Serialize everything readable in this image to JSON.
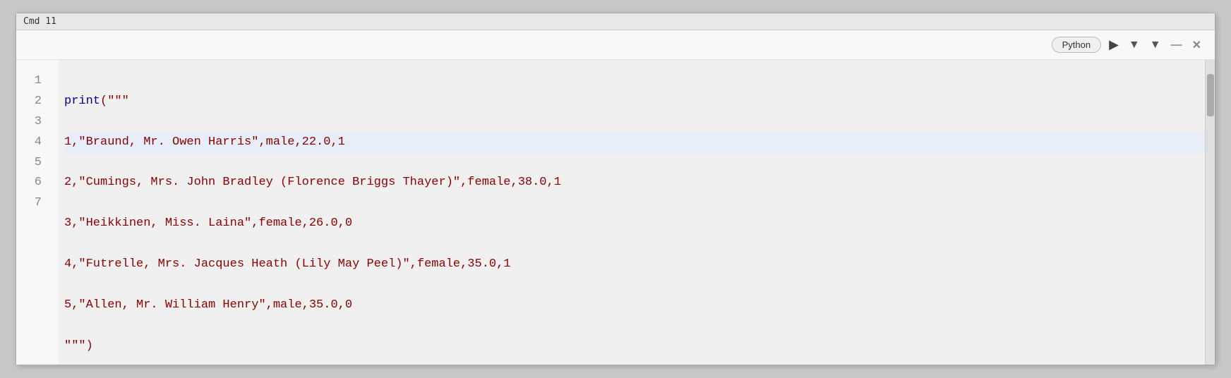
{
  "titleBar": {
    "label": "Cmd 11"
  },
  "toolbar": {
    "language": "Python",
    "play_label": "▶",
    "dropdown_label": "▾",
    "down_label": "▼",
    "minimize_label": "—",
    "close_label": "✕"
  },
  "editor": {
    "lines": [
      {
        "number": "1",
        "content": "print(\"\"\""
      },
      {
        "number": "2",
        "content": "1,\"Braund, Mr. Owen Harris\",male,22.0,1"
      },
      {
        "number": "3",
        "content": "2,\"Cumings, Mrs. John Bradley (Florence Briggs Thayer)\",female,38.0,1"
      },
      {
        "number": "4",
        "content": "3,\"Heikkinen, Miss. Laina\",female,26.0,0"
      },
      {
        "number": "5",
        "content": "4,\"Futrelle, Mrs. Jacques Heath (Lily May Peel)\",female,35.0,1"
      },
      {
        "number": "6",
        "content": "5,\"Allen, Mr. William Henry\",male,35.0,0"
      },
      {
        "number": "7",
        "content": "\"\"\")"
      }
    ]
  }
}
